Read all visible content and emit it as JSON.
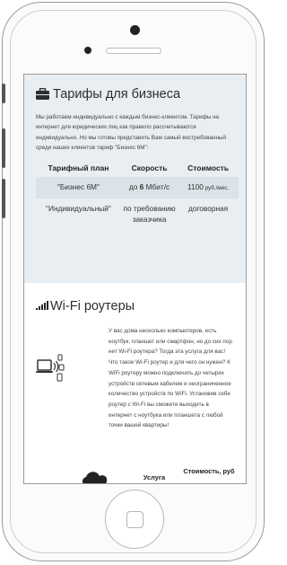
{
  "business": {
    "title": "Тарифы для бизнеса",
    "icon": "briefcase-icon",
    "intro": "Мы работаем индивидуально с каждым бизнес-клиентом. Тарифы на интернет для юридических лиц как правило рассчитываются индивидуально. Но мы готовы представить Вам самый востребованный среди наших клиентов тариф \"Бизнес 6М\":",
    "table": {
      "headers": [
        "Тарифный план",
        "Скорость",
        "Стоимость"
      ],
      "rows": [
        {
          "plan": "\"Бизнес 6М\"",
          "speed_prefix": "до ",
          "speed_value": "6",
          "speed_suffix": " Мбит/с",
          "price": "1100",
          "price_unit": " руб./мес."
        },
        {
          "plan": "\"Индивидуальный\"",
          "speed": "по требованию заказчика",
          "price": "договорная"
        }
      ]
    }
  },
  "wifi": {
    "title": "Wi-Fi роутеры",
    "icon": "signal-bars-icon",
    "text": "У вас дома несколько компьютеров, есть ноутбук, планшет или смартфон, но до сих пор нет Wi-Fi роутера? Тогда эта услуга для вас! Что такое Wi-Fi роутер и для чего он нужен? К WiFi роутеру можно подключить до четырех устройств сетевым кабелем и неограниченное количество устройств по WiFi. Установив себе роутер с Wi-Fi вы сможете выходить в интернет с ноутбука или планшета с любой точки вашей квартиры!",
    "columns": {
      "service": "Услуга",
      "price": "Стоимость, руб"
    }
  },
  "colors": {
    "section_bg": "#e8eef2",
    "row_highlight": "#dbe3e8",
    "text": "#333333"
  }
}
